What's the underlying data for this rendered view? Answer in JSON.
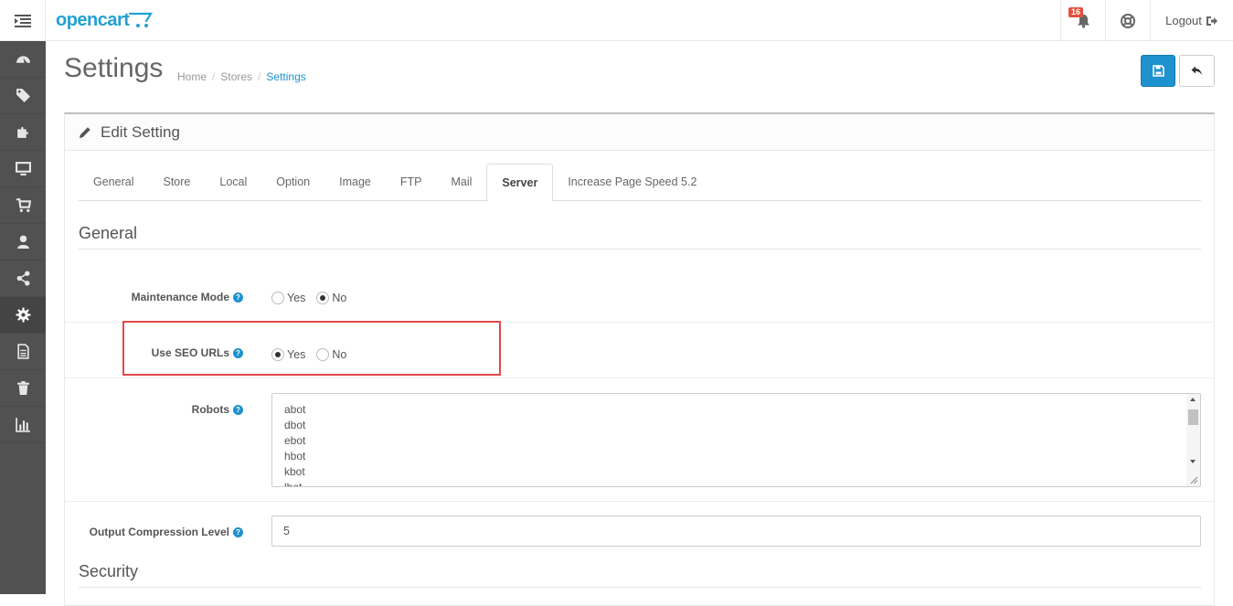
{
  "header": {
    "logo_text": "opencart",
    "notification_count": "16",
    "logout_label": "Logout"
  },
  "sidebar": {
    "items": [
      {
        "icon": "dashboard-icon"
      },
      {
        "icon": "tags-icon"
      },
      {
        "icon": "puzzle-icon"
      },
      {
        "icon": "desktop-icon"
      },
      {
        "icon": "cart-icon"
      },
      {
        "icon": "user-icon"
      },
      {
        "icon": "share-icon"
      },
      {
        "icon": "gear-icon",
        "active": true
      },
      {
        "icon": "report-file-icon"
      },
      {
        "icon": "trash-icon"
      },
      {
        "icon": "bar-chart-icon"
      }
    ]
  },
  "page": {
    "title": "Settings",
    "breadcrumb": [
      "Home",
      "Stores",
      "Settings"
    ]
  },
  "panel": {
    "title": "Edit Setting",
    "tabs": [
      "General",
      "Store",
      "Local",
      "Option",
      "Image",
      "FTP",
      "Mail",
      "Server",
      "Increase Page Speed 5.2"
    ],
    "active_tab": "Server",
    "section_general": "General",
    "section_security": "Security",
    "maintenance": {
      "label": "Maintenance Mode",
      "yes": "Yes",
      "no": "No",
      "value": "No"
    },
    "seo_urls": {
      "label": "Use SEO URLs",
      "yes": "Yes",
      "no": "No",
      "value": "Yes"
    },
    "robots": {
      "label": "Robots",
      "lines": [
        "abot",
        "dbot",
        "ebot",
        "hbot",
        "kbot",
        "lbot"
      ]
    },
    "compression": {
      "label": "Output Compression Level",
      "value": "5"
    }
  },
  "colors": {
    "accent": "#1e91cf",
    "sidebar_bg": "#515151",
    "highlight": "#e0494b",
    "badge": "#e3503e"
  }
}
